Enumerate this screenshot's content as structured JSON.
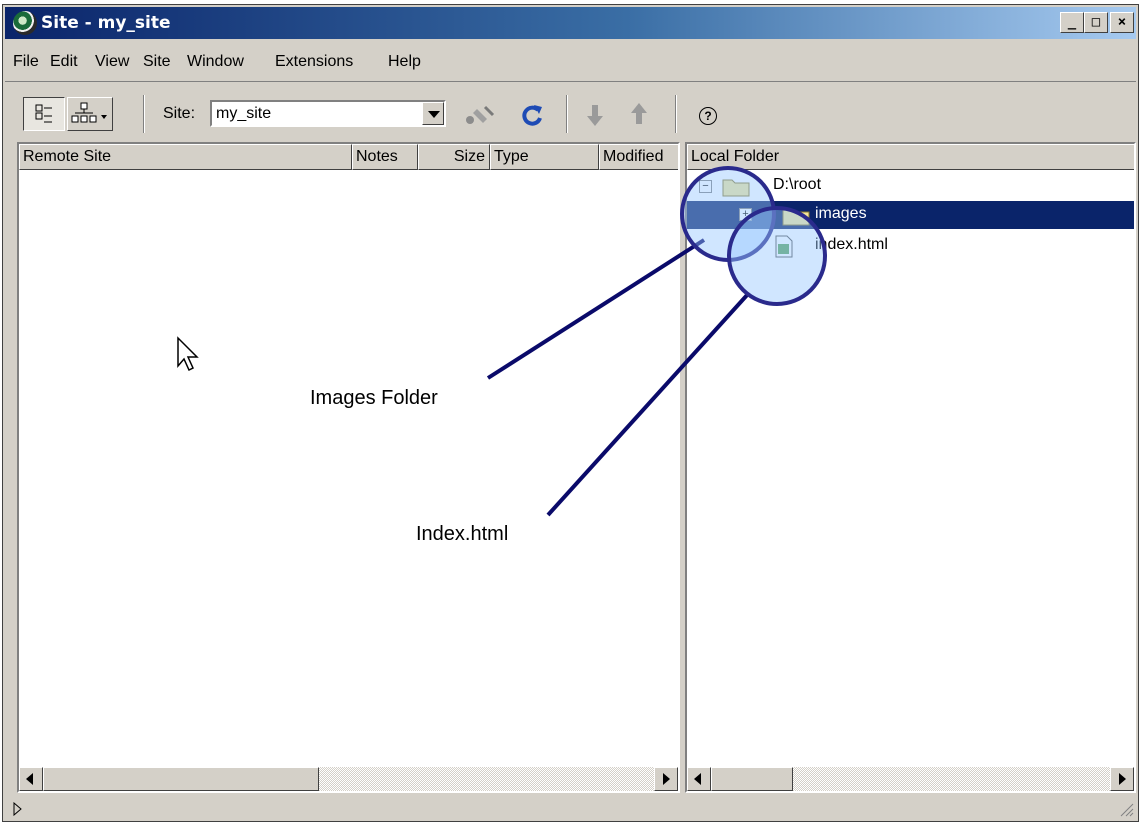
{
  "window": {
    "title": "Site - my_site",
    "min_label": "_",
    "max_label": "□",
    "close_label": "×"
  },
  "menu": [
    "File",
    "Edit",
    "View",
    "Site",
    "Window",
    "Extensions",
    "Help"
  ],
  "toolbar": {
    "site_label": "Site:",
    "site_value": "my_site",
    "help_label": "?"
  },
  "remote_pane": {
    "columns": [
      "Remote Site",
      "Notes",
      "Size",
      "Type",
      "Modified"
    ]
  },
  "local_pane": {
    "column": "Local Folder",
    "tree": [
      {
        "label": "D:\\root",
        "expander": "−"
      },
      {
        "label": "images",
        "expander": "+",
        "selected": true
      },
      {
        "label": "index.html"
      }
    ]
  },
  "annotations": {
    "images": "Images Folder",
    "index": "Index.html"
  },
  "colors": {
    "title_start": "#0a246a",
    "title_end": "#a6caf0",
    "selection": "#0a246a",
    "callout_line": "#0a0a6a"
  }
}
